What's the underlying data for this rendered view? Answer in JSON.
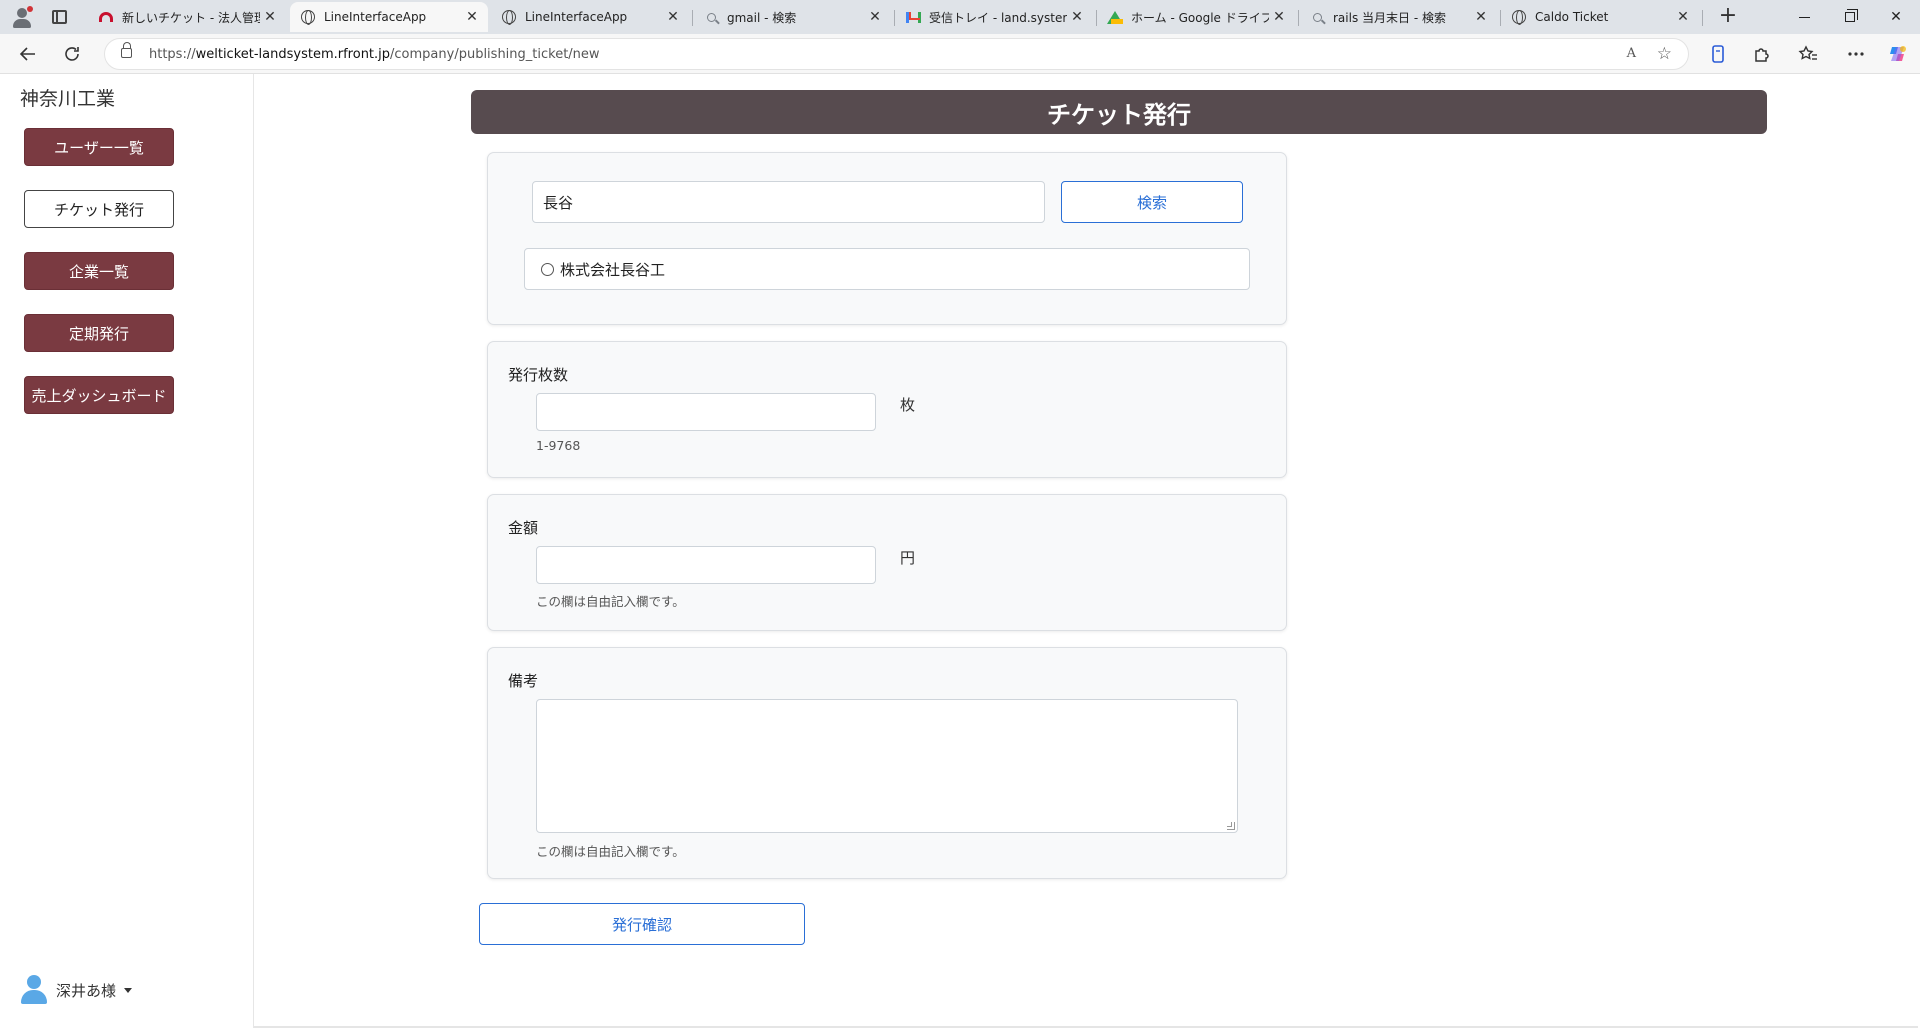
{
  "browser": {
    "tabs": [
      {
        "title": "新しいチケット - 法人管理ペ",
        "icon": "red-arc-icon"
      },
      {
        "title": "LineInterfaceApp",
        "icon": "globe-icon"
      },
      {
        "title": "LineInterfaceApp",
        "icon": "globe-icon"
      },
      {
        "title": "gmail - 検索",
        "icon": "search-icon"
      },
      {
        "title": "受信トレイ - land.system.at",
        "icon": "gmail-icon"
      },
      {
        "title": "ホーム - Google ドライブ",
        "icon": "drive-icon"
      },
      {
        "title": "rails 当月末日 - 検索",
        "icon": "search-icon"
      },
      {
        "title": "Caldo Ticket",
        "icon": "globe-icon"
      }
    ],
    "close_glyph": "✕",
    "new_tab_glyph": "+",
    "url_prefix": "https://",
    "url_host": "welticket-landsystem.rfront.jp",
    "url_path": "/company/publishing_ticket/new",
    "read_aloud_glyph": "A",
    "favorite_glyph": "☆"
  },
  "sidebar": {
    "company_name": "神奈川工業",
    "items": [
      {
        "label": "ユーザー一覧",
        "active": false
      },
      {
        "label": "チケット発行",
        "active": true
      },
      {
        "label": "企業一覧",
        "active": false
      },
      {
        "label": "定期発行",
        "active": false
      },
      {
        "label": "売上ダッシュボード",
        "active": false
      }
    ],
    "user_name": "深井あ様"
  },
  "header": {
    "title": "チケット発行"
  },
  "company_search": {
    "query": "長谷",
    "button_label": "検索",
    "results": [
      {
        "label": "株式会社長谷工",
        "selected": false
      }
    ]
  },
  "quantity": {
    "label": "発行枚数",
    "value": "",
    "unit": "枚",
    "hint": "1-9768"
  },
  "amount": {
    "label": "金額",
    "value": "",
    "unit": "円",
    "hint": "この欄は自由記入欄です。"
  },
  "remarks": {
    "label": "備考",
    "value": "",
    "hint": "この欄は自由記入欄です。"
  },
  "confirm_button": {
    "label": "発行確認"
  },
  "colors": {
    "nav_filled": "#7a3a41",
    "header_bg": "#574b4f",
    "primary_blue": "#2a6fd6",
    "card_bg": "#f8f9fa"
  }
}
